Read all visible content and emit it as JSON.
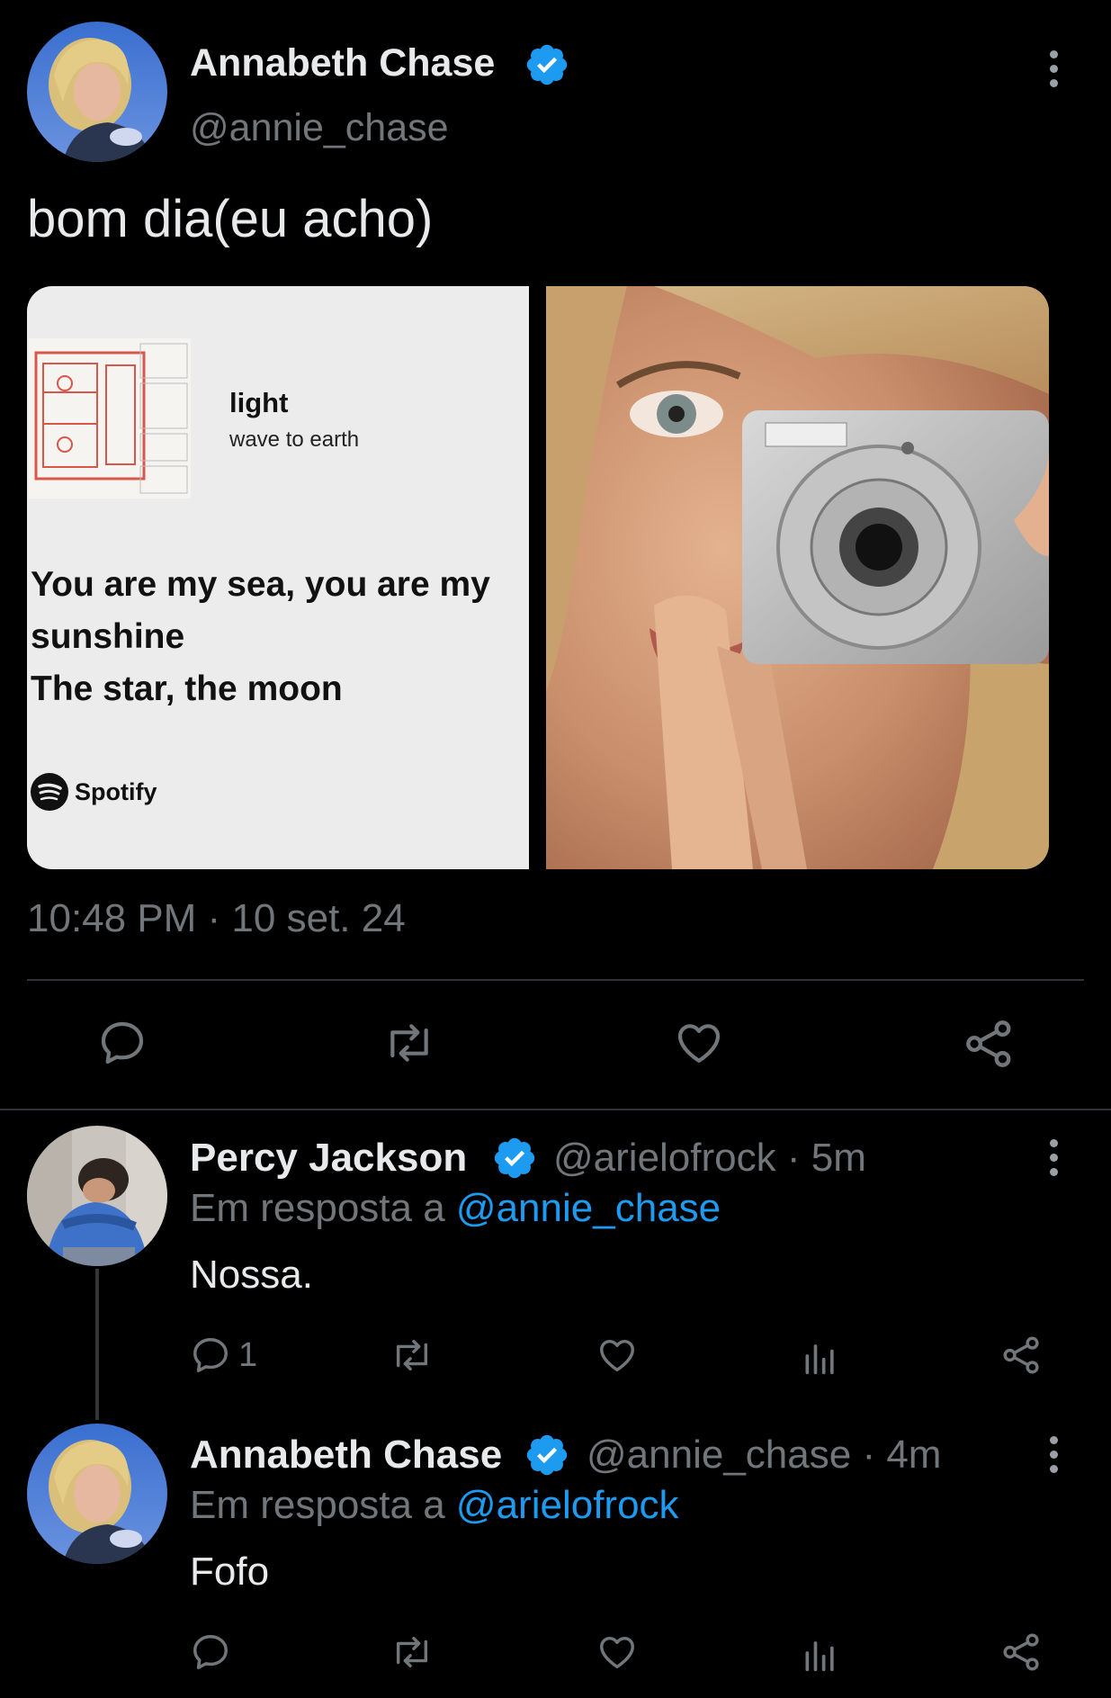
{
  "main_tweet": {
    "author_name": "Annabeth Chase",
    "author_handle": "@annie_chase",
    "text": "bom dia(eu acho)",
    "timestamp": "10:48 PM · 10 set. 24",
    "spotify_card": {
      "song_title": "light",
      "artist": "wave to earth",
      "lyrics_line1": "You are my sea, you are my",
      "lyrics_line2": "sunshine",
      "lyrics_line3": "The star, the moon",
      "brand": "Spotify"
    }
  },
  "replies": [
    {
      "author_name": "Percy Jackson",
      "author_handle": "@arielofrock",
      "time": "5m",
      "reply_prefix": "Em resposta a",
      "reply_to": "@annie_chase",
      "text": "Nossa.",
      "reply_count": "1"
    },
    {
      "author_name": "Annabeth Chase",
      "author_handle": "@annie_chase",
      "time": "4m",
      "reply_prefix": "Em resposta a",
      "reply_to": "@arielofrock",
      "text": "Fofo"
    }
  ],
  "colors": {
    "background": "#000000",
    "text": "#e7e9ea",
    "muted": "#71767b",
    "accent": "#1d9bf0"
  },
  "icons": {
    "reply": "speech-bubble-icon",
    "retweet": "retweet-icon",
    "like": "heart-icon",
    "share": "share-icon",
    "views": "bar-chart-icon",
    "more": "kebab-icon",
    "verified": "verified-badge-icon"
  }
}
